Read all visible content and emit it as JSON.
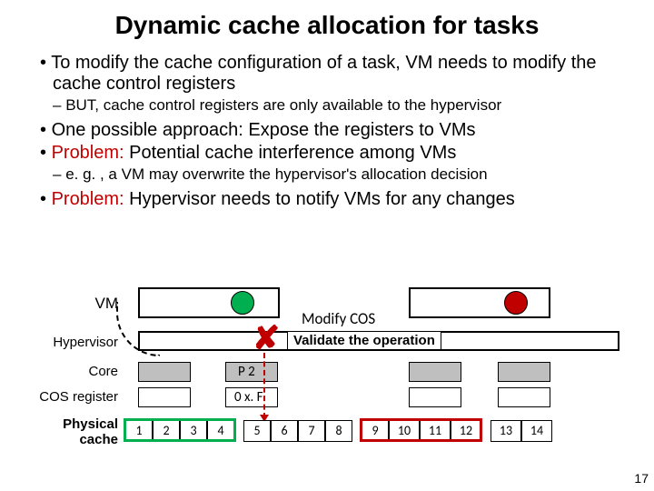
{
  "title": "Dynamic cache allocation for tasks",
  "bullets": {
    "b1": "To modify the cache configuration of a task, VM needs to modify the cache control registers",
    "s1": "BUT, cache control registers are only available to the hypervisor",
    "b2": "One possible approach: Expose the registers to VMs",
    "b3_pre": "Problem:",
    "b3_rest": " Potential cache interference among VMs",
    "s2": "e. g. , a VM may overwrite the hypervisor's allocation decision",
    "b4_pre": "Problem:",
    "b4_rest": " Hypervisor needs to notify VMs for any changes"
  },
  "labels": {
    "vm": "VM",
    "hypervisor": "Hypervisor",
    "core": "Core",
    "cosreg": "COS register",
    "physcache": "Physical cache",
    "modifycos": "Modify COS",
    "validate": "Validate the operation",
    "p2": "P 2",
    "oxf": "0 x. F"
  },
  "cells": [
    "1",
    "2",
    "3",
    "4",
    "5",
    "6",
    "7",
    "8",
    "9",
    "10",
    "11",
    "12",
    "13",
    "14"
  ],
  "page": "17"
}
